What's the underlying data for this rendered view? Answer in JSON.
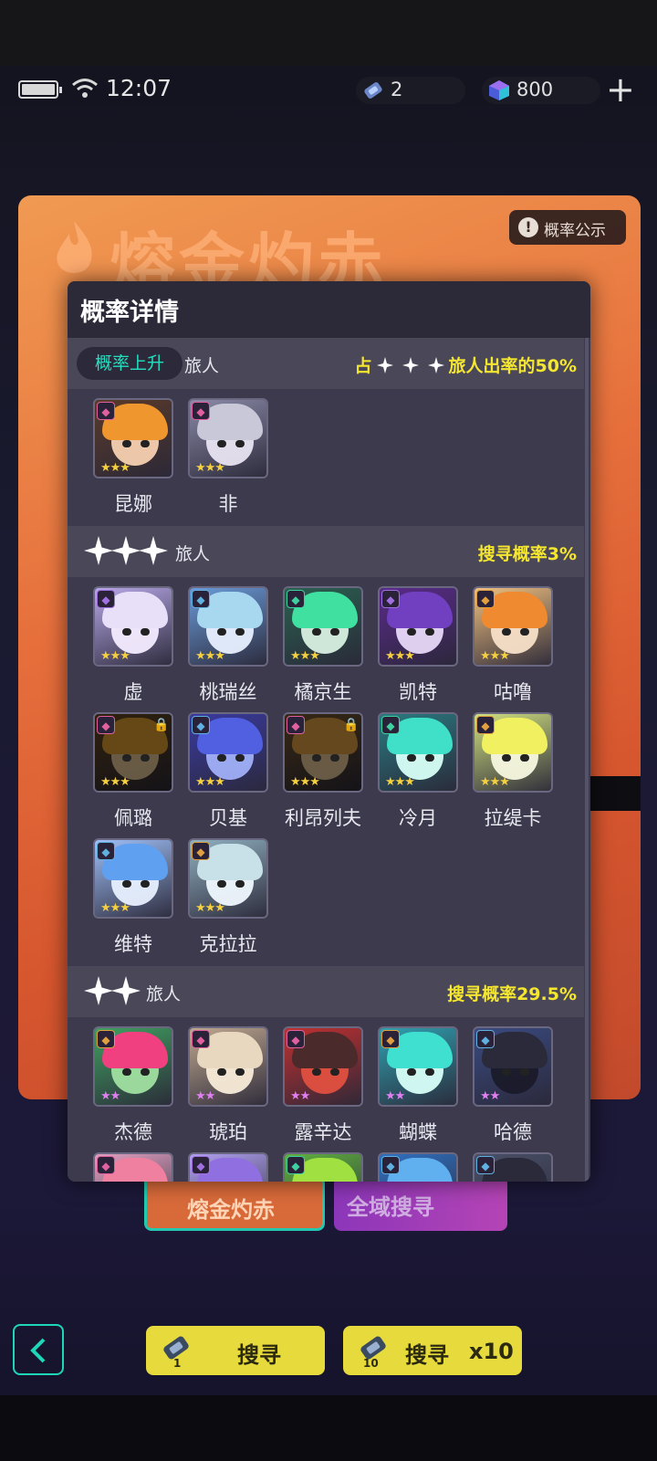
{
  "status": {
    "time": "12:07",
    "tickets": "2",
    "gems": "800"
  },
  "banner": {
    "title": "熔金灼赤",
    "prob_button": "概率公示"
  },
  "modal": {
    "title": "概率详情",
    "sections": [
      {
        "badge": "概率上升",
        "name": "旅人",
        "rate_prefix": "占",
        "rate": "旅人出率的50%",
        "characters": [
          {
            "name": "昆娜",
            "stars": 3,
            "locked": false,
            "hair": "#f0962e",
            "bg": "#5a3a2a",
            "face": "#f5d0b0",
            "cls": "#e060a0"
          },
          {
            "name": "非",
            "stars": 3,
            "locked": false,
            "hair": "#c8c8d8",
            "bg": "#8a8aa8",
            "face": "#e8e4f0",
            "cls": "#e060a0"
          }
        ]
      },
      {
        "stars": 3,
        "name": "旅人",
        "rate": "搜寻概率3%",
        "characters": [
          {
            "name": "虚",
            "stars": 3,
            "locked": false,
            "hair": "#e8e0f8",
            "bg": "#b8a8e8",
            "face": "#f4ecff",
            "cls": "#a070e0"
          },
          {
            "name": "桃瑞丝",
            "stars": 3,
            "locked": false,
            "hair": "#a8d8f0",
            "bg": "#6a9ad8",
            "face": "#e8f0ff",
            "cls": "#60b0e0"
          },
          {
            "name": "橘京生",
            "stars": 3,
            "locked": false,
            "hair": "#40e0a0",
            "bg": "#2a6050",
            "face": "#d8f0e0",
            "cls": "#40d0a0"
          },
          {
            "name": "凯特",
            "stars": 3,
            "locked": false,
            "hair": "#7040c0",
            "bg": "#5a2a8a",
            "face": "#e8d8f8",
            "cls": "#a070e0"
          },
          {
            "name": "咕噜",
            "stars": 3,
            "locked": false,
            "hair": "#f08a30",
            "bg": "#f0c080",
            "face": "#f8e0c8",
            "cls": "#e0a040"
          },
          {
            "name": "佩璐",
            "stars": 3,
            "locked": true,
            "hair": "#e0a030",
            "bg": "#6a4a20",
            "face": "#f0d0a0",
            "cls": "#e060a0"
          },
          {
            "name": "贝基",
            "stars": 3,
            "locked": false,
            "hair": "#5060e0",
            "bg": "#3a3aa0",
            "face": "#a0b0f8",
            "cls": "#60b0e0"
          },
          {
            "name": "利昂列夫",
            "stars": 3,
            "locked": true,
            "hair": "#e0a040",
            "bg": "#7a5a30",
            "face": "#f0d0a0",
            "cls": "#e060a0"
          },
          {
            "name": "冷月",
            "stars": 3,
            "locked": false,
            "hair": "#40e0c8",
            "bg": "#2a7a80",
            "face": "#d8fff8",
            "cls": "#40d0a0"
          },
          {
            "name": "拉缇卡",
            "stars": 3,
            "locked": false,
            "hair": "#f0f060",
            "bg": "#d0e080",
            "face": "#f8f8e0",
            "cls": "#e0a040"
          },
          {
            "name": "维特",
            "stars": 3,
            "locked": false,
            "hair": "#60a0f0",
            "bg": "#a0c0f8",
            "face": "#e8f0ff",
            "cls": "#60b0e0"
          },
          {
            "name": "克拉拉",
            "stars": 3,
            "locked": false,
            "hair": "#c8e0e8",
            "bg": "#90b0c0",
            "face": "#f0f8ff",
            "cls": "#e0a040"
          }
        ]
      },
      {
        "stars": 2,
        "name": "旅人",
        "rate": "搜寻概率29.5%",
        "characters": [
          {
            "name": "杰德",
            "stars": 2,
            "locked": false,
            "hair": "#f04080",
            "bg": "#40a060",
            "face": "#a0e0a0",
            "cls": "#e0a040"
          },
          {
            "name": "琥珀",
            "stars": 2,
            "locked": false,
            "hair": "#e8d8c0",
            "bg": "#c0a890",
            "face": "#f8ecd8",
            "cls": "#e060a0"
          },
          {
            "name": "露辛达",
            "stars": 2,
            "locked": false,
            "hair": "#4a2a2a",
            "bg": "#c03030",
            "face": "#e05040",
            "cls": "#e060a0"
          },
          {
            "name": "蝴蝶",
            "stars": 2,
            "locked": false,
            "hair": "#40e0d0",
            "bg": "#30a0b0",
            "face": "#d8fff8",
            "cls": "#e0a040"
          },
          {
            "name": "哈德",
            "stars": 2,
            "locked": false,
            "hair": "#2a2a3a",
            "bg": "#3a4a80",
            "face": "#1a1a2a",
            "cls": "#60b0e0"
          },
          {
            "name": "",
            "stars": 2,
            "locked": false,
            "hair": "#f080a0",
            "bg": "#e0a0c0",
            "face": "#f8d8e8",
            "cls": "#e060a0"
          },
          {
            "name": "",
            "stars": 2,
            "locked": false,
            "hair": "#9070e0",
            "bg": "#b0a0f0",
            "face": "#e8e0ff",
            "cls": "#a070e0"
          },
          {
            "name": "",
            "stars": 2,
            "locked": false,
            "hair": "#a0e040",
            "bg": "#60b040",
            "face": "#e0f8c0",
            "cls": "#40d0a0"
          },
          {
            "name": "",
            "stars": 2,
            "locked": false,
            "hair": "#60b0f0",
            "bg": "#3070c0",
            "face": "#f0b040",
            "cls": "#60b0e0"
          },
          {
            "name": "",
            "stars": 2,
            "locked": false,
            "hair": "#2a2a3a",
            "bg": "#4a5068",
            "face": "#3a3a4a",
            "cls": "#60b0e0"
          }
        ]
      }
    ]
  },
  "tabs": [
    "熔金灼赤",
    "全域搜寻"
  ],
  "actions": {
    "search_once": "搜寻",
    "search_once_count": "1",
    "search_ten": "搜寻",
    "search_ten_mult": "x10",
    "search_ten_count": "10"
  },
  "colors": {
    "accent_teal": "#22e0c0",
    "rate_yellow": "#f5e630",
    "button_yellow": "#e6da3c",
    "modal_bg": "#3c3a4c",
    "banner_orange": "#e66f3c"
  },
  "icons": {
    "battery": "battery-icon",
    "wifi": "wifi-icon",
    "ticket": "ticket-icon",
    "gem": "gem-icon",
    "plus": "plus-icon",
    "back": "chevron-left-icon",
    "info": "info-icon",
    "star": "star-icon",
    "lock": "lock-icon"
  }
}
